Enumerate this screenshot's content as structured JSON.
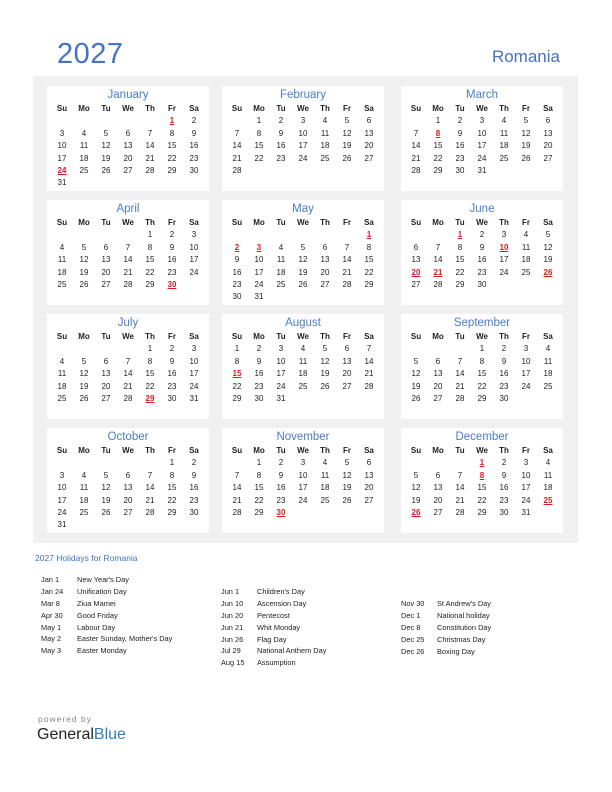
{
  "header": {
    "year": "2027",
    "country": "Romania"
  },
  "weekdays": [
    "Su",
    "Mo",
    "Tu",
    "We",
    "Th",
    "Fr",
    "Sa"
  ],
  "colors": {
    "accent": "#4472c4",
    "holiday": "#e0191f",
    "background": "#f0f0f0"
  },
  "months": [
    {
      "name": "January",
      "start": 5,
      "days": 31,
      "holidays": [
        1,
        24
      ]
    },
    {
      "name": "February",
      "start": 1,
      "days": 28,
      "holidays": []
    },
    {
      "name": "March",
      "start": 1,
      "days": 31,
      "holidays": [
        8
      ]
    },
    {
      "name": "April",
      "start": 4,
      "days": 30,
      "holidays": [
        30
      ]
    },
    {
      "name": "May",
      "start": 6,
      "days": 31,
      "holidays": [
        1,
        2,
        3
      ]
    },
    {
      "name": "June",
      "start": 2,
      "days": 30,
      "holidays": [
        1,
        10,
        20,
        21,
        26
      ]
    },
    {
      "name": "July",
      "start": 4,
      "days": 31,
      "holidays": [
        29
      ]
    },
    {
      "name": "August",
      "start": 0,
      "days": 31,
      "holidays": [
        15
      ]
    },
    {
      "name": "September",
      "start": 3,
      "days": 30,
      "holidays": []
    },
    {
      "name": "October",
      "start": 5,
      "days": 31,
      "holidays": []
    },
    {
      "name": "November",
      "start": 1,
      "days": 30,
      "holidays": [
        30
      ]
    },
    {
      "name": "December",
      "start": 3,
      "days": 31,
      "holidays": [
        1,
        8,
        25,
        26
      ]
    }
  ],
  "holidays_title": "2027 Holidays for Romania",
  "holiday_columns": [
    [
      {
        "date": "Jan 1",
        "name": "New Year's Day"
      },
      {
        "date": "Jan 24",
        "name": "Unification Day"
      },
      {
        "date": "Mar 8",
        "name": "Ziua Mamei"
      },
      {
        "date": "Apr 30",
        "name": "Good Friday"
      },
      {
        "date": "May 1",
        "name": "Labour Day"
      },
      {
        "date": "May 2",
        "name": "Easter Sunday, Mother's Day"
      },
      {
        "date": "May 3",
        "name": "Easter Monday"
      }
    ],
    [
      {
        "date": "Jun 1",
        "name": "Children's Day"
      },
      {
        "date": "Jun 10",
        "name": "Ascension Day"
      },
      {
        "date": "Jun 20",
        "name": "Pentecost"
      },
      {
        "date": "Jun 21",
        "name": "Whit Monday"
      },
      {
        "date": "Jun 26",
        "name": "Flag Day"
      },
      {
        "date": "Jul 29",
        "name": "National Anthem Day"
      },
      {
        "date": "Aug 15",
        "name": "Assumption"
      }
    ],
    [
      {
        "date": "Nov 30",
        "name": "St Andrew's Day"
      },
      {
        "date": "Dec 1",
        "name": "National holiday"
      },
      {
        "date": "Dec 8",
        "name": "Constitution Day"
      },
      {
        "date": "Dec 25",
        "name": "Christmas Day"
      },
      {
        "date": "Dec 26",
        "name": "Boxing Day"
      }
    ]
  ],
  "footer": {
    "powered_by": "powered by",
    "brand_general": "General",
    "brand_blue": "Blue"
  }
}
